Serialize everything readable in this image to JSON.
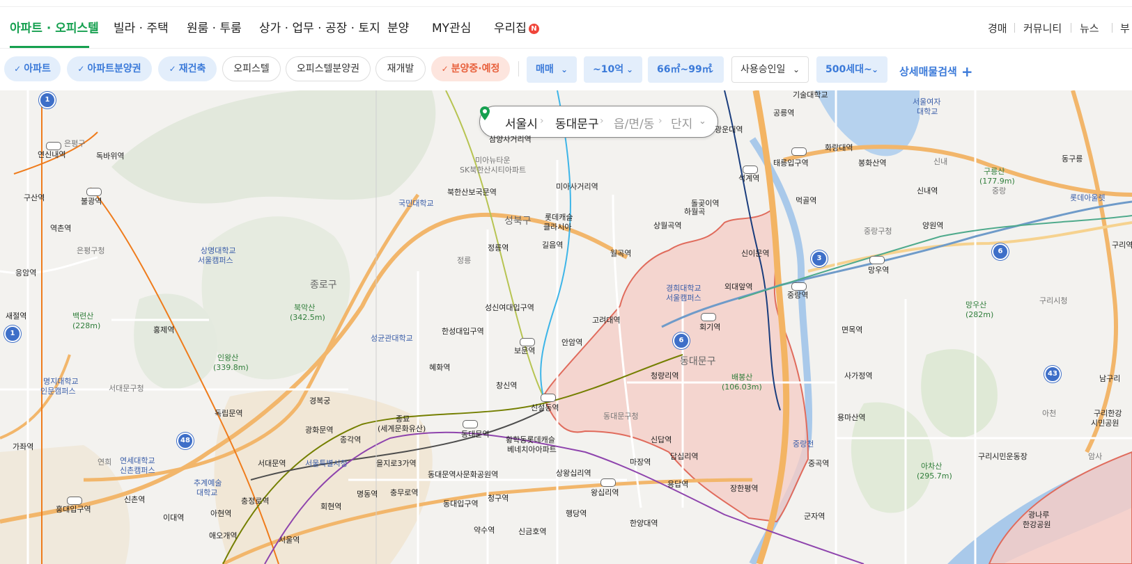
{
  "nav": {
    "tabs": [
      {
        "label": "아파트 · 오피스텔"
      },
      {
        "label": "빌라 · 주택"
      },
      {
        "label": "원룸 · 투룸"
      },
      {
        "label": "상가 · 업무 · 공장 · 토지"
      },
      {
        "label": "분양"
      },
      {
        "label": "MY관심"
      },
      {
        "label": "우리집"
      }
    ],
    "new_badge": "N",
    "util": [
      "경매",
      "커뮤니티",
      "뉴스",
      "부"
    ]
  },
  "filters": {
    "chips": [
      "아파트",
      "아파트분양권",
      "재건축",
      "오피스텔",
      "오피스텔분양권",
      "재개발",
      "분양중·예정"
    ],
    "check_glyph": "✓",
    "dropdowns": [
      "매매",
      "~10억",
      "66㎡~99㎡",
      "사용승인일",
      "500세대~"
    ],
    "detail_search": "상세매물검색",
    "plus": "+"
  },
  "breadcrumb": {
    "city": "서울시",
    "district": "동대문구",
    "dong": "읍/면/동",
    "complex": "단지"
  },
  "map": {
    "labels": [
      "은평구",
      "연신내역",
      "독바위역",
      "구산역",
      "불광역",
      "역촌역",
      "은평구청",
      "응암역",
      "새절역",
      "백련산",
      "(228m)",
      "홍제역",
      "명지대학교",
      "인문캠퍼스",
      "서대문구청",
      "독립문역",
      "가좌역",
      "연희",
      "연세대학교",
      "신촌캠퍼스",
      "추계예술",
      "대학교",
      "신촌역",
      "이대역",
      "아현역",
      "홍대입구역",
      "애오개역",
      "서대문역",
      "충정로역",
      "서울역",
      "종로구",
      "북악산",
      "(342.5m)",
      "인왕산",
      "(339.8m)",
      "경복궁",
      "광화문역",
      "종각역",
      "서울특별시청",
      "을지로3가역",
      "충무로역",
      "명동역",
      "회현역",
      "종묘",
      "(세계문화유산)",
      "동대문역",
      "동대문역사문화공원역",
      "동대입구역",
      "약수역",
      "신금호역",
      "청구역",
      "행당역",
      "상명대학교",
      "서울캠퍼스",
      "국민대학교",
      "성균관대학교",
      "혜화역",
      "한성대입구역",
      "성신여대입구역",
      "창신역",
      "보문역",
      "신설동역",
      "안암역",
      "황학동롯데캐슬",
      "베네치아아파트",
      "고려대역",
      "성북구",
      "롯데캐슬",
      "클라시아",
      "길음역",
      "정릉역",
      "정릉",
      "미아사거리역",
      "미아뉴타운",
      "SK북한산시티아파트",
      "삼양사거리역",
      "북한산보국문역",
      "월곡역",
      "상월곡역",
      "돌곶이역",
      "하월곡",
      "석계역",
      "광운대역",
      "신이문역",
      "외대앞역",
      "경희대학교",
      "서울캠퍼스",
      "회기역",
      "동대문구",
      "청량리역",
      "배봉산",
      "(106.03m)",
      "동대문구청",
      "신답역",
      "답십리역",
      "마장역",
      "용답역",
      "장한평역",
      "상왕십리역",
      "왕십리역",
      "한양대역",
      "군자역",
      "중곡역",
      "중랑천",
      "기술대학교",
      "서울여자",
      "대학교",
      "공릉역",
      "화랑대역",
      "태릉입구역",
      "먹골역",
      "봉화산역",
      "신내",
      "신내역",
      "중랑구청",
      "양원역",
      "망우역",
      "중랑역",
      "면목역",
      "사가정역",
      "용마산역",
      "망우산",
      "(282m)",
      "구리시청",
      "구릉산",
      "(177.9m)",
      "중랑",
      "동구릉",
      "롯데아울렛",
      "구리역",
      "아천",
      "구리한강",
      "시민공원",
      "구리시민운동장",
      "아차산",
      "(295.7m)",
      "암사",
      "광나루",
      "한강공원",
      "남구리"
    ]
  }
}
